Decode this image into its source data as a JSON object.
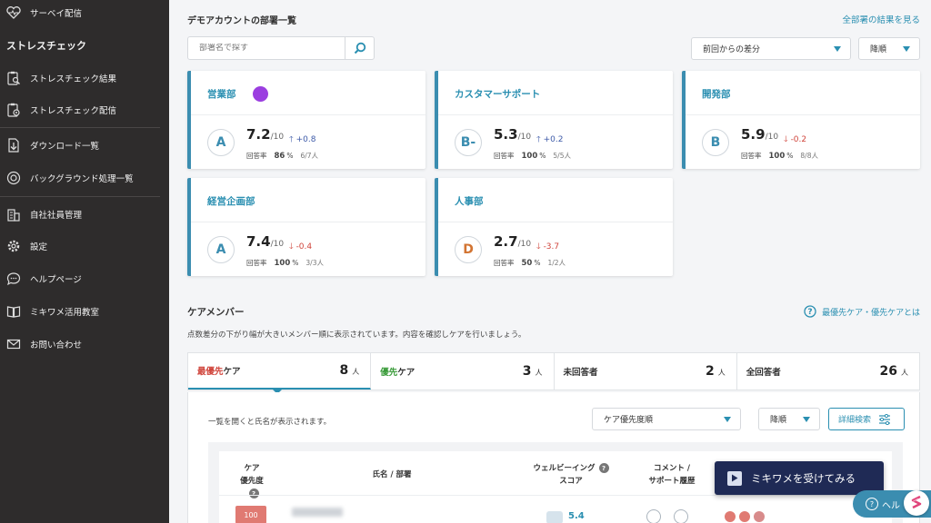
{
  "sidebar": {
    "top_item": {
      "label": "サーベイ配信",
      "icon": "heart-chart-icon"
    },
    "section_title": "ストレスチェック",
    "items": [
      {
        "label": "ストレスチェック結果",
        "icon": "clipboard-search-icon"
      },
      {
        "label": "ストレスチェック配信",
        "icon": "clipboard-gear-icon"
      },
      {
        "label": "ダウンロード一覧",
        "icon": "download-icon"
      },
      {
        "label": "バックグラウンド処理一覧",
        "icon": "background-process-icon"
      },
      {
        "label": "自社社員管理",
        "icon": "building-icon"
      },
      {
        "label": "設定",
        "icon": "gear-icon"
      },
      {
        "label": "ヘルプページ",
        "icon": "chat-bubble-icon"
      },
      {
        "label": "ミキワメ活用教室",
        "icon": "book-icon"
      },
      {
        "label": "お問い合わせ",
        "icon": "mail-icon"
      }
    ]
  },
  "departments": {
    "title": "デモアカウントの部署一覧",
    "view_all_link": "全部署の結果を見る",
    "search_placeholder": "部署名で探す",
    "sort_select": "前回からの差分",
    "order_select": "降順",
    "response_label": "回答率",
    "score_denominator": "/10",
    "cards": [
      {
        "name": "営業部",
        "grade": "A",
        "score": "7.2",
        "diff": "+0.8",
        "direction": "up",
        "rate": "86",
        "rate_unit": "%",
        "count": "6/7人"
      },
      {
        "name": "カスタマーサポート",
        "grade": "B-",
        "score": "5.3",
        "diff": "+0.2",
        "direction": "up",
        "rate": "100",
        "rate_unit": "%",
        "count": "5/5人"
      },
      {
        "name": "開発部",
        "grade": "B",
        "score": "5.9",
        "diff": "-0.2",
        "direction": "down",
        "rate": "100",
        "rate_unit": "%",
        "count": "8/8人"
      },
      {
        "name": "経営企画部",
        "grade": "A",
        "score": "7.4",
        "diff": "-0.4",
        "direction": "down",
        "rate": "100",
        "rate_unit": "%",
        "count": "3/3人"
      },
      {
        "name": "人事部",
        "grade": "D",
        "score": "2.7",
        "diff": "-3.7",
        "direction": "down",
        "rate": "50",
        "rate_unit": "%",
        "count": "1/2人"
      }
    ]
  },
  "care": {
    "title": "ケアメンバー",
    "help_link": "最優先ケア・優先ケアとは",
    "description": "点数差分の下がり幅が大きいメンバー順に表示されています。内容を確認しケアを行いましょう。",
    "tabs": [
      {
        "prefix": "最優先",
        "suffix": "ケア",
        "count": "8",
        "unit": "人",
        "prefix_color": "red",
        "active": true
      },
      {
        "prefix": "優先",
        "suffix": "ケア",
        "count": "3",
        "unit": "人",
        "prefix_color": "green",
        "active": false
      },
      {
        "prefix": "",
        "suffix": "未回答者",
        "count": "2",
        "unit": "人",
        "prefix_color": "",
        "active": false
      },
      {
        "prefix": "",
        "suffix": "全回答者",
        "count": "26",
        "unit": "人",
        "prefix_color": "",
        "active": false
      }
    ],
    "panel_note": "一覧を開くと氏名が表示されます。",
    "care_sort_select": "ケア優先度順",
    "care_order_select": "降順",
    "detail_search_button": "詳細検索",
    "table_headers": {
      "priority_line1": "ケア",
      "priority_line2": "優先度",
      "name": "氏名 / 部署",
      "wellbeing_line1": "ウェルビーイング",
      "wellbeing_line2": "スコア",
      "comment_line1": "コメント /",
      "comment_line2": "サポート履歴"
    },
    "row_priority": "100",
    "row_score": "5.4"
  },
  "cta_button": "ミキワメを受けてみる",
  "help_button": "ヘル",
  "colors": {
    "accent": "#2a8fb1",
    "sidebar_bg": "#2e2c2c",
    "cta_bg": "#1f2a55",
    "up": "#3d5aa8",
    "down": "#d0453c",
    "priority_red": "#d0453c",
    "priority_green": "#3a9b3a"
  }
}
